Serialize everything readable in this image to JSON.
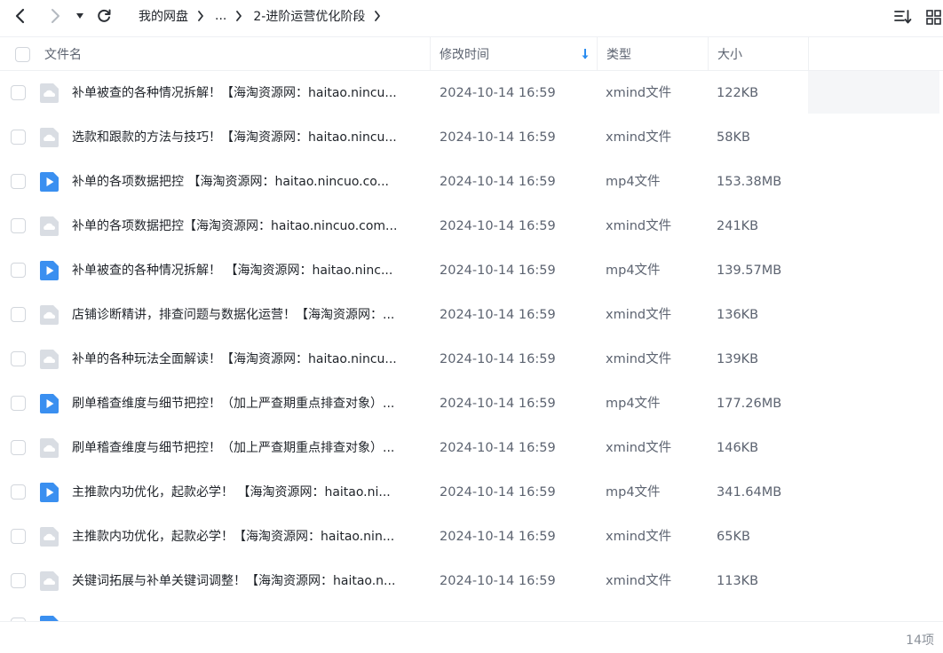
{
  "toolbar": {
    "back_icon": "chevron-left-icon",
    "forward_icon": "chevron-right-icon",
    "history_icon": "caret-down-icon",
    "refresh_icon": "refresh-icon",
    "sort_icon": "sort-list-icon",
    "view_icon": "grid-view-icon"
  },
  "breadcrumb": {
    "items": [
      "我的网盘",
      "...",
      "2-进阶运营优化阶段"
    ]
  },
  "header": {
    "name": "文件名",
    "modified": "修改时间",
    "type": "类型",
    "size": "大小",
    "sort_indicator": "sort-desc-arrow-icon"
  },
  "colors": {
    "accent": "#2b8df0",
    "doc_icon_bg": "#d9dde3",
    "video_icon_bg": "#3a8ff0"
  },
  "files": [
    {
      "name": "补单被查的各种情况拆解！【海淘资源网：haitao.nincu...",
      "modified": "2024-10-14 16:59",
      "type": "xmind文件",
      "size": "122KB",
      "icon": "doc"
    },
    {
      "name": "选款和跟款的方法与技巧！【海淘资源网：haitao.nincu...",
      "modified": "2024-10-14 16:59",
      "type": "xmind文件",
      "size": "58KB",
      "icon": "doc"
    },
    {
      "name": "补单的各项数据把控 【海淘资源网：haitao.nincuo.co...",
      "modified": "2024-10-14 16:59",
      "type": "mp4文件",
      "size": "153.38MB",
      "icon": "video"
    },
    {
      "name": "补单的各项数据把控【海淘资源网：haitao.nincuo.com...",
      "modified": "2024-10-14 16:59",
      "type": "xmind文件",
      "size": "241KB",
      "icon": "doc"
    },
    {
      "name": "补单被查的各种情况拆解！ 【海淘资源网：haitao.ninc...",
      "modified": "2024-10-14 16:59",
      "type": "mp4文件",
      "size": "139.57MB",
      "icon": "video"
    },
    {
      "name": "店铺诊断精讲，排查问题与数据化运营！【海淘资源网：...",
      "modified": "2024-10-14 16:59",
      "type": "xmind文件",
      "size": "136KB",
      "icon": "doc"
    },
    {
      "name": "补单的各种玩法全面解读！【海淘资源网：haitao.nincu...",
      "modified": "2024-10-14 16:59",
      "type": "xmind文件",
      "size": "139KB",
      "icon": "doc"
    },
    {
      "name": "刷单稽查维度与细节把控！（加上严查期重点排查对象）...",
      "modified": "2024-10-14 16:59",
      "type": "mp4文件",
      "size": "177.26MB",
      "icon": "video"
    },
    {
      "name": "刷单稽查维度与细节把控！（加上严查期重点排查对象）...",
      "modified": "2024-10-14 16:59",
      "type": "xmind文件",
      "size": "146KB",
      "icon": "doc"
    },
    {
      "name": "主推款内功优化，起款必学！ 【海淘资源网：haitao.ni...",
      "modified": "2024-10-14 16:59",
      "type": "mp4文件",
      "size": "341.64MB",
      "icon": "video"
    },
    {
      "name": "主推款内功优化，起款必学！【海淘资源网：haitao.nin...",
      "modified": "2024-10-14 16:59",
      "type": "xmind文件",
      "size": "65KB",
      "icon": "doc"
    },
    {
      "name": "关键词拓展与补单关键词调整！【海淘资源网：haitao.n...",
      "modified": "2024-10-14 16:59",
      "type": "xmind文件",
      "size": "113KB",
      "icon": "doc"
    },
    {
      "name": "",
      "modified": "",
      "type": "",
      "size": "",
      "icon": "video"
    }
  ],
  "footer": {
    "count": "14项"
  }
}
